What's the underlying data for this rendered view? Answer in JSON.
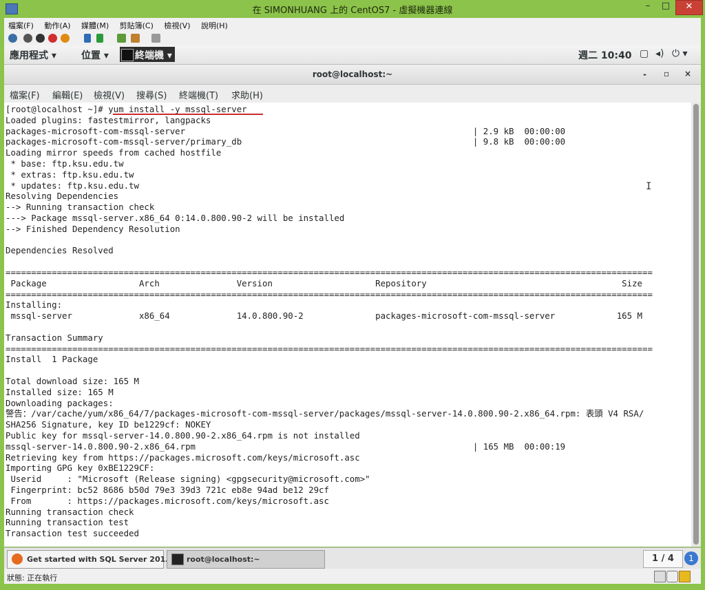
{
  "window": {
    "title": "在 SIMONHUANG 上的 CentOS7 - 虛擬機器連線",
    "minimize": "–",
    "maximize": "□",
    "close": "✕"
  },
  "host_menu": [
    "檔案(F)",
    "動作(A)",
    "媒體(M)",
    "剪貼簿(C)",
    "檢視(V)",
    "說明(H)"
  ],
  "gnome_panel": {
    "applications": "應用程式 ▾",
    "places": "位置 ▾",
    "terminal": "終端機 ▾",
    "clock": "週二 10:40",
    "power": "⏻ ▾"
  },
  "terminal_window": {
    "title": "root@localhost:~",
    "minimize": "-",
    "maximize": "▫",
    "close": "×"
  },
  "terminal_menu": [
    "檔案(F)",
    "編輯(E)",
    "檢視(V)",
    "搜尋(S)",
    "終端機(T)",
    "求助(H)"
  ],
  "terminal_lines": [
    "[root@localhost ~]# yum install -y mssql-server",
    "Loaded plugins: fastestmirror, langpacks",
    "packages-microsoft-com-mssql-server                                                        | 2.9 kB  00:00:00",
    "packages-microsoft-com-mssql-server/primary_db                                             | 9.8 kB  00:00:00",
    "Loading mirror speeds from cached hostfile",
    " * base: ftp.ksu.edu.tw",
    " * extras: ftp.ksu.edu.tw",
    " * updates: ftp.ksu.edu.tw",
    "Resolving Dependencies",
    "--> Running transaction check",
    "---> Package mssql-server.x86_64 0:14.0.800.90-2 will be installed",
    "--> Finished Dependency Resolution",
    "",
    "Dependencies Resolved",
    "",
    "==============================================================================================================================",
    " Package                  Arch               Version                    Repository                                      Size",
    "==============================================================================================================================",
    "Installing:",
    " mssql-server             x86_64             14.0.800.90-2              packages-microsoft-com-mssql-server            165 M",
    "",
    "Transaction Summary",
    "==============================================================================================================================",
    "Install  1 Package",
    "",
    "Total download size: 165 M",
    "Installed size: 165 M",
    "Downloading packages:",
    "警告：/var/cache/yum/x86_64/7/packages-microsoft-com-mssql-server/packages/mssql-server-14.0.800.90-2.x86_64.rpm: 表頭 V4 RSA/",
    "SHA256 Signature, key ID be1229cf: NOKEY",
    "Public key for mssql-server-14.0.800.90-2.x86_64.rpm is not installed",
    "mssql-server-14.0.800.90-2.x86_64.rpm                                                      | 165 MB  00:00:19",
    "Retrieving key from https://packages.microsoft.com/keys/microsoft.asc",
    "Importing GPG key 0xBE1229CF:",
    " Userid     : \"Microsoft (Release signing) <gpgsecurity@microsoft.com>\"",
    " Fingerprint: bc52 8686 b50d 79e3 39d3 721c eb8e 94ad be12 29cf",
    " From       : https://packages.microsoft.com/keys/microsoft.asc",
    "Running transaction check",
    "Running transaction test",
    "Transaction test succeeded"
  ],
  "taskbar": {
    "task1": "Get started with SQL Server 201…",
    "task2": "root@localhost:~",
    "pager": "1 / 4",
    "pager_badge": "1"
  },
  "status": {
    "label": "狀態: 正在執行"
  },
  "colors": {
    "chrome": "#8cc34a",
    "close": "#c94135",
    "underline": "#cc2a2a"
  }
}
